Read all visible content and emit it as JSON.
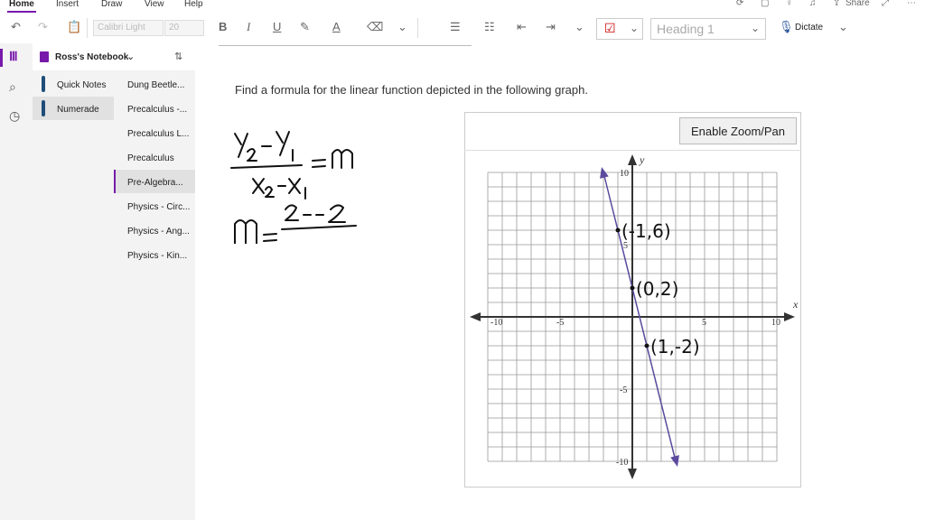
{
  "menu": {
    "home": "Home",
    "insert": "Insert",
    "draw": "Draw",
    "view": "View",
    "help": "Help",
    "share": "Share"
  },
  "toolbar": {
    "font_name": "Calibri Light",
    "font_size": "20",
    "bold": "B",
    "italic": "I",
    "underline": "U",
    "style": "Heading 1",
    "dictate": "Dictate"
  },
  "notebook": {
    "name": "Ross's Notebook"
  },
  "sections": [
    {
      "label": "Quick Notes",
      "color": "#1f4e79"
    },
    {
      "label": "Numerade",
      "color": "#1f4e79"
    }
  ],
  "pages": [
    {
      "label": "Dung Beetle..."
    },
    {
      "label": "Precalculus -..."
    },
    {
      "label": "Precalculus L..."
    },
    {
      "label": "Precalculus"
    },
    {
      "label": "Pre-Algebra..."
    },
    {
      "label": "Physics - Circ..."
    },
    {
      "label": "Physics - Ang..."
    },
    {
      "label": "Physics - Kin..."
    }
  ],
  "content": {
    "question": "Find a formula for the linear function depicted in the following graph.",
    "zoom_button": "Enable Zoom/Pan"
  },
  "graph": {
    "x_label": "x",
    "y_label": "y",
    "tick_labels": {
      "x_neg10": "-10",
      "x_neg5": "-5",
      "x_5": "5",
      "x_10": "10",
      "y_10": "10",
      "y_5": "5",
      "y_neg5": "-5",
      "y_neg10": "-10"
    },
    "line_color": "#5b4a9e",
    "points": [
      {
        "x": -1,
        "y": 6,
        "label": "(-1,6)"
      },
      {
        "x": 0,
        "y": 2,
        "label": "(0,2)"
      },
      {
        "x": 1,
        "y": -2,
        "label": "(1,-2)"
      }
    ]
  },
  "ink": {
    "formula_m": "m",
    "subst_numerator": "2 - -2"
  }
}
